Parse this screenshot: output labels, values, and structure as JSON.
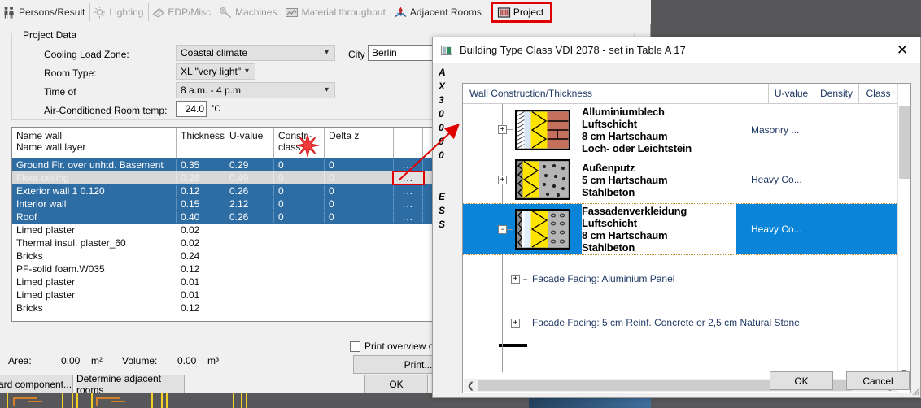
{
  "tabs": [
    {
      "label": "Persons/Result",
      "icon": "persons-icon",
      "state": "enabled"
    },
    {
      "label": "Lighting",
      "icon": "lighting-icon",
      "state": "disabled"
    },
    {
      "label": "EDP/Misc",
      "icon": "edp-icon",
      "state": "disabled"
    },
    {
      "label": "Machines",
      "icon": "machines-icon",
      "state": "disabled"
    },
    {
      "label": "Material throughput",
      "icon": "material-icon",
      "state": "disabled"
    },
    {
      "label": "Adjacent Rooms",
      "icon": "adjacent-rooms-icon",
      "state": "enabled"
    },
    {
      "label": "Project",
      "icon": "project-icon",
      "state": "active"
    }
  ],
  "project_data": {
    "legend": "Project Data",
    "cooling_load_zone": {
      "label": "Cooling Load Zone:",
      "value": "Coastal climate"
    },
    "room_type": {
      "label": "Room Type:",
      "value": "XL \"very light\""
    },
    "time_of": {
      "label": "Time of",
      "value": "8 a.m. - 4 p.m"
    },
    "room_temp": {
      "label": "Air-Conditioned Room temp:",
      "value": "24.0",
      "unit": "°C"
    },
    "city": {
      "label": "City",
      "value": "Berlin"
    }
  },
  "wall_table": {
    "headers": [
      "Name wall\nName wall layer",
      "Thickness",
      "U-value",
      "Constr.-\nclass",
      "Delta z",
      ""
    ],
    "header_line1": "Name wall",
    "header_line2": "Name wall layer",
    "h_thickness": "Thickness",
    "h_uvalue": "U-value",
    "h_constr1": "Constr.-",
    "h_constr2": "class",
    "h_deltaz": "Delta z",
    "rows": [
      {
        "name": "Ground Flr. over unhtd. Basement",
        "thickness": "0.35",
        "uvalue": "0.29",
        "constr": "0",
        "deltaz": "0",
        "more": "...",
        "style": "selected"
      },
      {
        "name": "Floor ceiling",
        "thickness": "0.28",
        "uvalue": "0.49",
        "constr": "0",
        "deltaz": "0",
        "more": "...",
        "style": "highlight"
      },
      {
        "name": "Exterior wall 1 0.120",
        "thickness": "0.12",
        "uvalue": "0.26",
        "constr": "0",
        "deltaz": "0",
        "more": "...",
        "style": "selected"
      },
      {
        "name": "Interior wall",
        "thickness": "0.15",
        "uvalue": "2.12",
        "constr": "0",
        "deltaz": "0",
        "more": "...",
        "style": "selected"
      },
      {
        "name": "Roof",
        "thickness": "0.40",
        "uvalue": "0.26",
        "constr": "0",
        "deltaz": "0",
        "more": "...",
        "style": "selected"
      },
      {
        "name": "Limed plaster",
        "thickness": "0.02",
        "uvalue": "",
        "constr": "",
        "deltaz": "",
        "more": "",
        "style": "layer"
      },
      {
        "name": "Thermal insul. plaster_60",
        "thickness": "0.02",
        "uvalue": "",
        "constr": "",
        "deltaz": "",
        "more": "",
        "style": "layer"
      },
      {
        "name": "Bricks",
        "thickness": "0.24",
        "uvalue": "",
        "constr": "",
        "deltaz": "",
        "more": "",
        "style": "layer"
      },
      {
        "name": "PF-solid foam.W035",
        "thickness": "0.12",
        "uvalue": "",
        "constr": "",
        "deltaz": "",
        "more": "",
        "style": "layer"
      },
      {
        "name": "Limed plaster",
        "thickness": "0.01",
        "uvalue": "",
        "constr": "",
        "deltaz": "",
        "more": "",
        "style": "layer"
      },
      {
        "name": "Limed plaster",
        "thickness": "0.01",
        "uvalue": "",
        "constr": "",
        "deltaz": "",
        "more": "",
        "style": "layer"
      },
      {
        "name": "Bricks",
        "thickness": "0.12",
        "uvalue": "",
        "constr": "",
        "deltaz": "",
        "more": "",
        "style": "layer"
      }
    ]
  },
  "footer": {
    "area_label": "Area:",
    "area_value": "0.00",
    "area_unit": "m²",
    "volume_label": "Volume:",
    "volume_value": "0.00",
    "volume_unit": "m³",
    "print_overview_label": "Print overview on",
    "print_button": "Print...",
    "ok_button": "OK",
    "standard_component_button": "ard component...",
    "determine_button": "Determine adjacent rooms"
  },
  "dialog": {
    "title": "Building Type Class VDI 2078 - set in Table A 17",
    "close_icon": "close-icon",
    "side_strip_chars": [
      "A",
      "X",
      "3",
      "0",
      "0",
      "0",
      "0",
      "",
      "E",
      "S",
      "S"
    ],
    "tree_header": {
      "main": "Wall Construction/Thickness",
      "uvalue": "U-value",
      "density": "Density",
      "class": "Class"
    },
    "tree_items": [
      {
        "expander": "+",
        "icon": "wall-section-masonry-icon",
        "label": "Alluminiumblech\nLuftschicht\n8 cm Hartschaum\nLoch- oder Leichtstein",
        "class_value": "Masonry ...",
        "selected": false
      },
      {
        "expander": "+",
        "icon": "wall-section-concrete-icon",
        "label": "Außenputz\n5 cm Hartschaum\nStahlbeton",
        "class_value": "Heavy Co...",
        "selected": false
      },
      {
        "expander": "-",
        "icon": "wall-section-facade-icon",
        "label": "Fassadenverkleidung\nLuftschicht\n8 cm Hartschaum\nStahlbeton",
        "class_value": "Heavy Co...",
        "selected": true
      }
    ],
    "tree_children": [
      {
        "expander": "+",
        "label": "Facade Facing: Aluminium Panel"
      },
      {
        "expander": "+",
        "label": "Facade Facing: 5 cm Reinf. Concrete or 2,5 cm Natural Stone"
      }
    ],
    "ok_button": "OK",
    "cancel_button": "Cancel"
  },
  "colors": {
    "selection_blue": "#2e6ca4",
    "tree_selection_blue": "#0a84d8",
    "accent_red": "#e00000",
    "window_gray": "#f0f0f0",
    "desktop_gray": "#58585a"
  }
}
